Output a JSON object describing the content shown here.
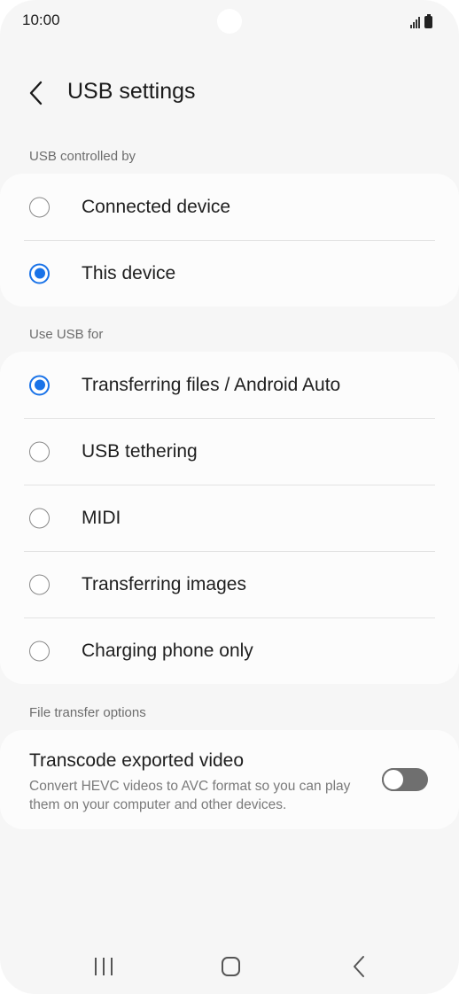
{
  "status_bar": {
    "time": "10:00",
    "icons": [
      "signal-icon",
      "battery-icon"
    ]
  },
  "header": {
    "title": "USB settings",
    "back_icon": "chevron-left-icon"
  },
  "sections": {
    "controlled_by": {
      "label": "USB controlled by",
      "options": [
        {
          "label": "Connected device",
          "selected": false
        },
        {
          "label": "This device",
          "selected": true
        }
      ]
    },
    "use_usb_for": {
      "label": "Use USB for",
      "options": [
        {
          "label": "Transferring files / Android Auto",
          "selected": true
        },
        {
          "label": "USB tethering",
          "selected": false
        },
        {
          "label": "MIDI",
          "selected": false
        },
        {
          "label": "Transferring images",
          "selected": false
        },
        {
          "label": "Charging phone only",
          "selected": false
        }
      ]
    },
    "file_transfer": {
      "label": "File transfer options",
      "transcode": {
        "title": "Transcode exported video",
        "description": "Convert HEVC videos to AVC format so you can play them on your computer and other devices.",
        "enabled": false
      }
    }
  },
  "nav_bar": {
    "icons": [
      "recent-apps-icon",
      "home-icon",
      "back-icon"
    ]
  },
  "colors": {
    "accent": "#1a73e8",
    "background": "#f6f6f6",
    "card": "#fcfcfc"
  }
}
